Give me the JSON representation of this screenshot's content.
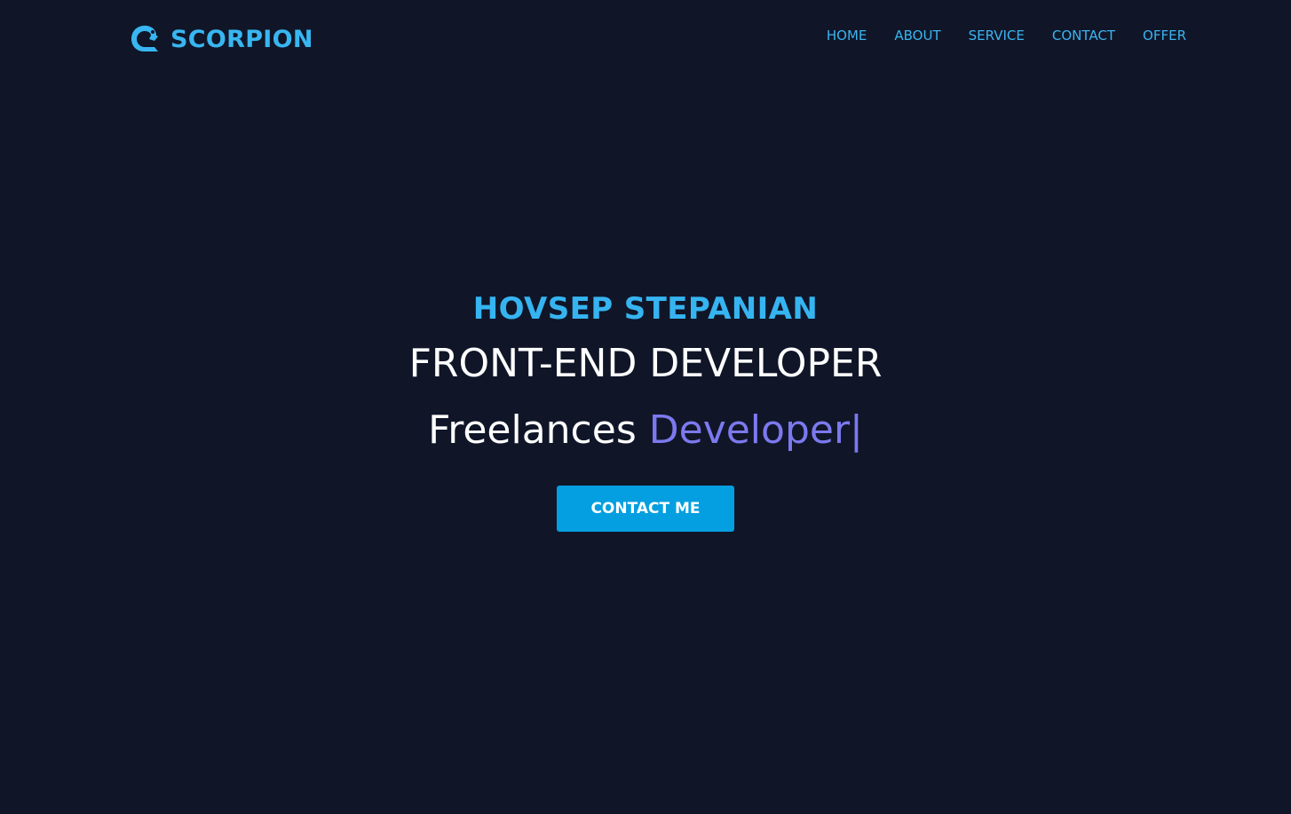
{
  "header": {
    "logo_text": "SCORPION",
    "logo_icon": "scorpion-tail-icon",
    "nav": [
      {
        "label": "HOME"
      },
      {
        "label": "ABOUT"
      },
      {
        "label": "SERVICE"
      },
      {
        "label": "CONTACT"
      },
      {
        "label": "OFFER"
      }
    ]
  },
  "hero": {
    "name": "HOVSEP STEPANIAN",
    "role": "FRONT-END DEVELOPER",
    "typed_prefix": "Freelances",
    "typed_word": "Developer",
    "typed_cursor": "|",
    "cta_label": "CONTACT ME"
  },
  "colors": {
    "background": "#101628",
    "accent": "#38b6f1",
    "button": "#049fe0",
    "typed_accent": "#7c79ef"
  }
}
